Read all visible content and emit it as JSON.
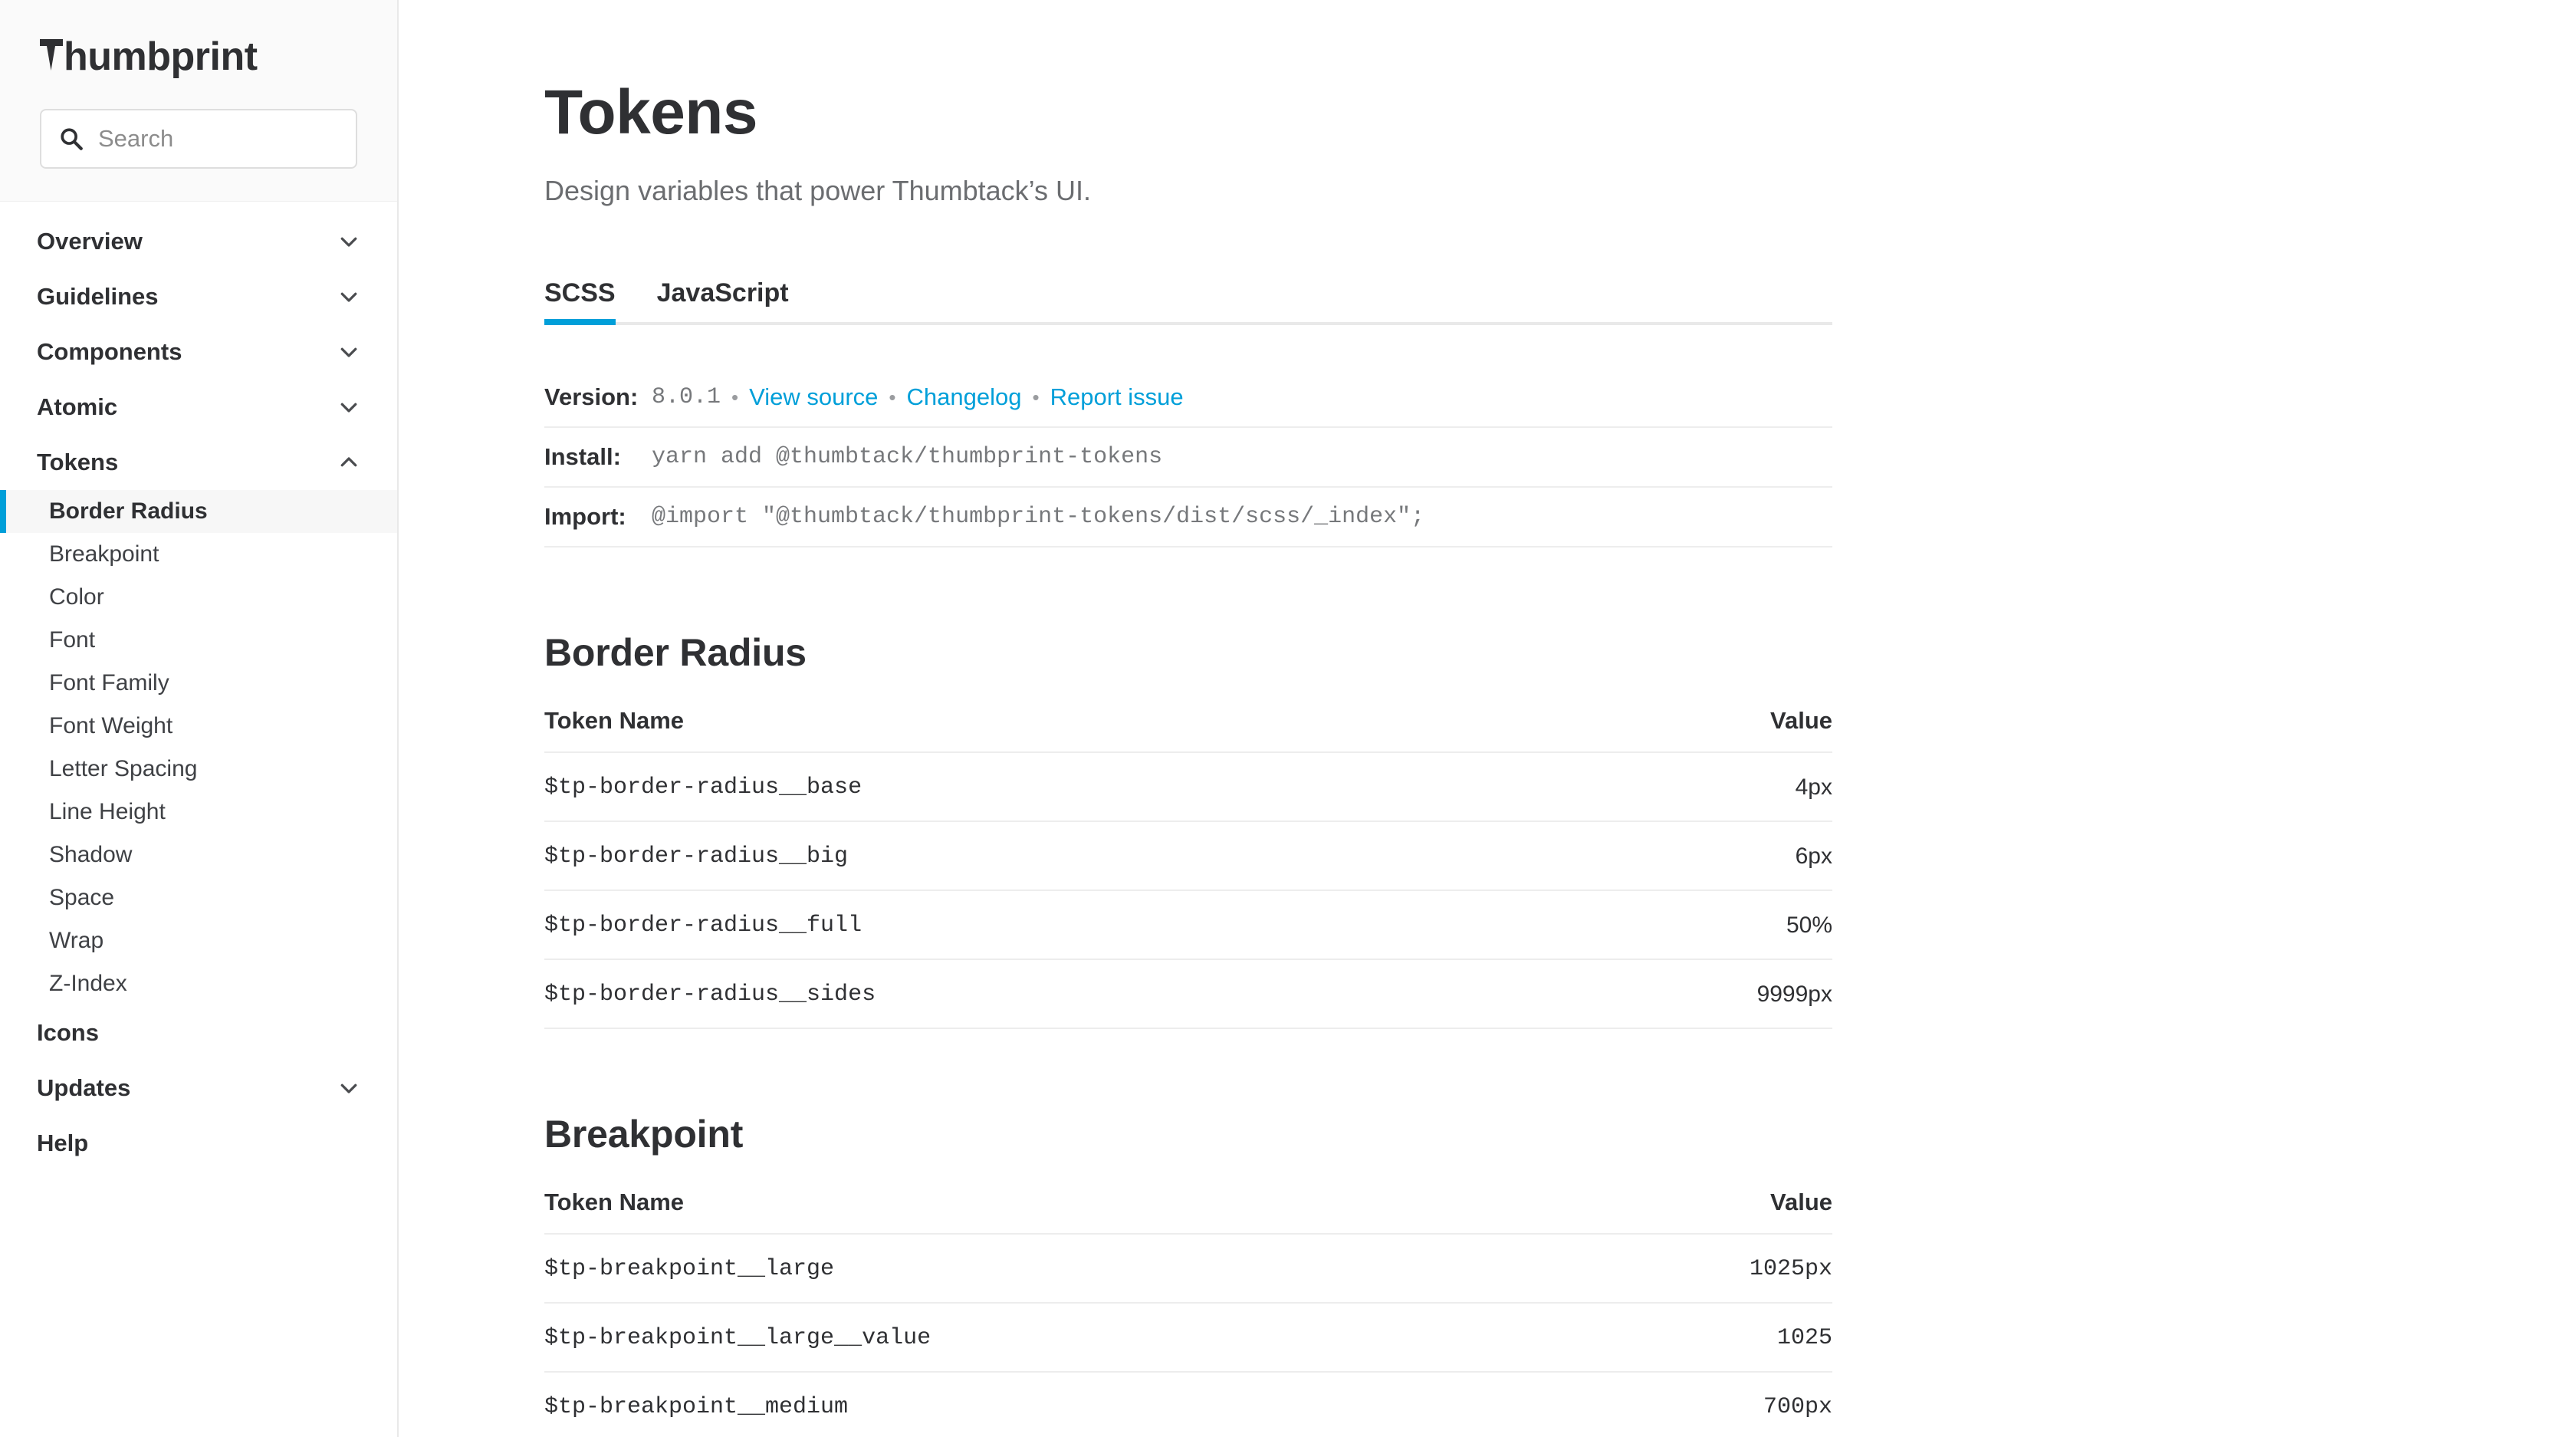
{
  "sidebar": {
    "logo_text": "humbprint",
    "search": {
      "placeholder": "Search",
      "value": ""
    },
    "groups": [
      {
        "label": "Overview",
        "icon": "chevron-down-icon",
        "expanded": false
      },
      {
        "label": "Guidelines",
        "icon": "chevron-down-icon",
        "expanded": false
      },
      {
        "label": "Components",
        "icon": "chevron-down-icon",
        "expanded": false
      },
      {
        "label": "Atomic",
        "icon": "chevron-down-icon",
        "expanded": false
      },
      {
        "label": "Tokens",
        "icon": "chevron-up-icon",
        "expanded": true
      }
    ],
    "token_items": [
      {
        "label": "Border Radius",
        "active": true
      },
      {
        "label": "Breakpoint",
        "active": false
      },
      {
        "label": "Color",
        "active": false
      },
      {
        "label": "Font",
        "active": false
      },
      {
        "label": "Font Family",
        "active": false
      },
      {
        "label": "Font Weight",
        "active": false
      },
      {
        "label": "Letter Spacing",
        "active": false
      },
      {
        "label": "Line Height",
        "active": false
      },
      {
        "label": "Shadow",
        "active": false
      },
      {
        "label": "Space",
        "active": false
      },
      {
        "label": "Wrap",
        "active": false
      },
      {
        "label": "Z-Index",
        "active": false
      }
    ],
    "icons_label": "Icons",
    "updates_label": "Updates",
    "help_label": "Help"
  },
  "main": {
    "title": "Tokens",
    "subtitle": "Design variables that power Thumbtack’s UI.",
    "tabs": [
      {
        "label": "SCSS",
        "active": true
      },
      {
        "label": "JavaScript",
        "active": false
      }
    ],
    "meta": {
      "version_label": "Version:",
      "version_value": "8.0.1",
      "links": [
        {
          "label": "View source"
        },
        {
          "label": "Changelog"
        },
        {
          "label": "Report issue"
        }
      ],
      "separator": "•",
      "install_label": "Install:",
      "install_value": "yarn add @thumbtack/thumbprint-tokens",
      "import_label": "Import:",
      "import_value": "@import \"@thumbtack/thumbprint-tokens/dist/scss/_index\";"
    },
    "sections": [
      {
        "title": "Border Radius",
        "columns": {
          "name": "Token Name",
          "value": "Value"
        },
        "value_font": "sans",
        "rows": [
          {
            "name": "$tp-border-radius__base",
            "value": "4px"
          },
          {
            "name": "$tp-border-radius__big",
            "value": "6px"
          },
          {
            "name": "$tp-border-radius__full",
            "value": "50%"
          },
          {
            "name": "$tp-border-radius__sides",
            "value": "9999px"
          }
        ]
      },
      {
        "title": "Breakpoint",
        "columns": {
          "name": "Token Name",
          "value": "Value"
        },
        "value_font": "mono",
        "rows": [
          {
            "name": "$tp-breakpoint__large",
            "value": "1025px"
          },
          {
            "name": "$tp-breakpoint__large__value",
            "value": "1025"
          },
          {
            "name": "$tp-breakpoint__medium",
            "value": "700px"
          }
        ]
      }
    ]
  },
  "colors": {
    "accent_blue": "#009fd9",
    "text_primary": "#2f3033",
    "text_secondary": "#6b6d70",
    "border": "#ededed"
  }
}
